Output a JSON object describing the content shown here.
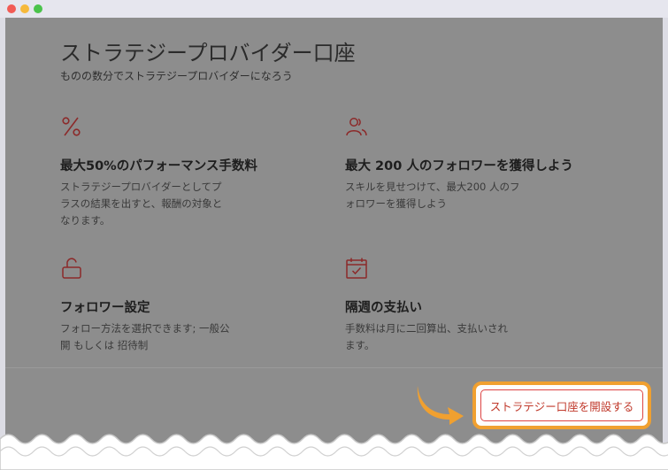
{
  "window": {
    "controls": [
      "close",
      "minimize",
      "maximize"
    ]
  },
  "page": {
    "title": "ストラテジープロバイダー口座",
    "subtitle": "ものの数分でストラテジープロバイダーになろう"
  },
  "features": [
    {
      "icon": "percent-icon",
      "title": "最大50%のパフォーマンス手数料",
      "desc_lines": [
        "ストラテジープロバイダーとしてプ",
        "ラスの結果を出すと、報酬の対象と",
        "なります。"
      ]
    },
    {
      "icon": "users-icon",
      "title": "最大 200 人のフォロワーを獲得しよう",
      "desc_lines": [
        "スキルを見せつけて、最大200 人のフ",
        "ォロワーを獲得しよう"
      ]
    },
    {
      "icon": "unlock-icon",
      "title": "フォロワー設定",
      "desc_lines": [
        "フォロー方法を選択できます; 一般公",
        "開 もしくは 招待制"
      ]
    },
    {
      "icon": "calendar-check-icon",
      "title": "隔週の支払い",
      "desc_lines": [
        "手数料は月に二回算出、支払いされ",
        "ます。"
      ]
    }
  ],
  "cta": {
    "label": "ストラテジー口座を開設する"
  },
  "colors": {
    "accent": "#c0392b",
    "highlight": "#f0a030",
    "overlay": "#8d8d8d"
  }
}
